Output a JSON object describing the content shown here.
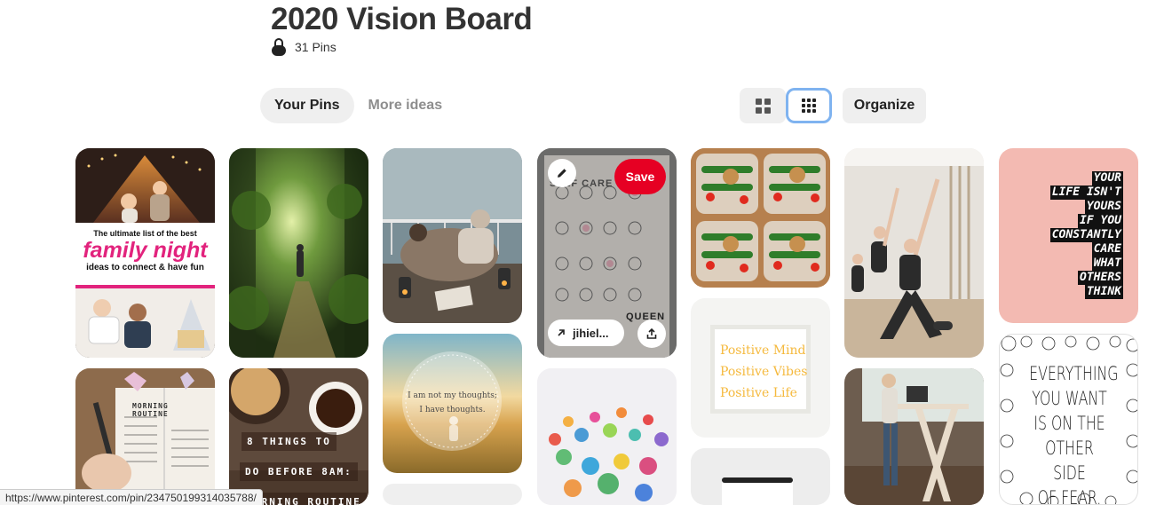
{
  "board": {
    "title": "2020 Vision Board",
    "pin_count": "31 Pins",
    "privacy_icon": "lock-icon"
  },
  "tabs": [
    {
      "label": "Your Pins",
      "active": true
    },
    {
      "label": "More ideas",
      "active": false
    }
  ],
  "toolbar": {
    "view_default_icon": "grid-2x2-icon",
    "view_compact_icon": "grid-3x3-icon",
    "selected_view": "compact",
    "organize_label": "Organize"
  },
  "pins": {
    "family_night": {
      "line1": "The ultimate list of the best",
      "line2": "family night",
      "line3": "ideas to connect & have fun"
    },
    "hover": {
      "save_label": "Save",
      "link_label": "jihiel...",
      "edit_icon": "pencil-icon",
      "link_icon": "arrow-up-right-icon",
      "share_icon": "share-icon",
      "text_top": "SELF CARE",
      "text_bottom": "QUEEN"
    },
    "quote_life": [
      "YOUR",
      "LIFE ISN'T",
      "YOURS",
      "IF YOU",
      "CONSTANTLY",
      "CARE",
      "WHAT",
      "OTHERS",
      "THINK"
    ],
    "thoughts": {
      "line1": "I am not my thoughts;",
      "line2": "I have thoughts."
    },
    "positive": [
      "Positive Mind",
      "Positive Vibes",
      "Positive Life"
    ],
    "eight_things": {
      "line1": "8 THINGS TO",
      "line2": "DO BEFORE 8AM:",
      "line3": "ORNING ROUTINE"
    },
    "morning_routine": "MORNING ROUTINE",
    "fear": [
      "EVERYTHING",
      "YOU WANT",
      "IS ON THE",
      "OTHER SIDE",
      "OF FEAR."
    ]
  },
  "status_bar": {
    "url": "https://www.pinterest.com/pin/234750199314035788/"
  },
  "colors": {
    "accent_red": "#e60023",
    "pink": "#e2237d",
    "selected_outline": "#7fb3f0",
    "button_gray": "#efefef"
  }
}
